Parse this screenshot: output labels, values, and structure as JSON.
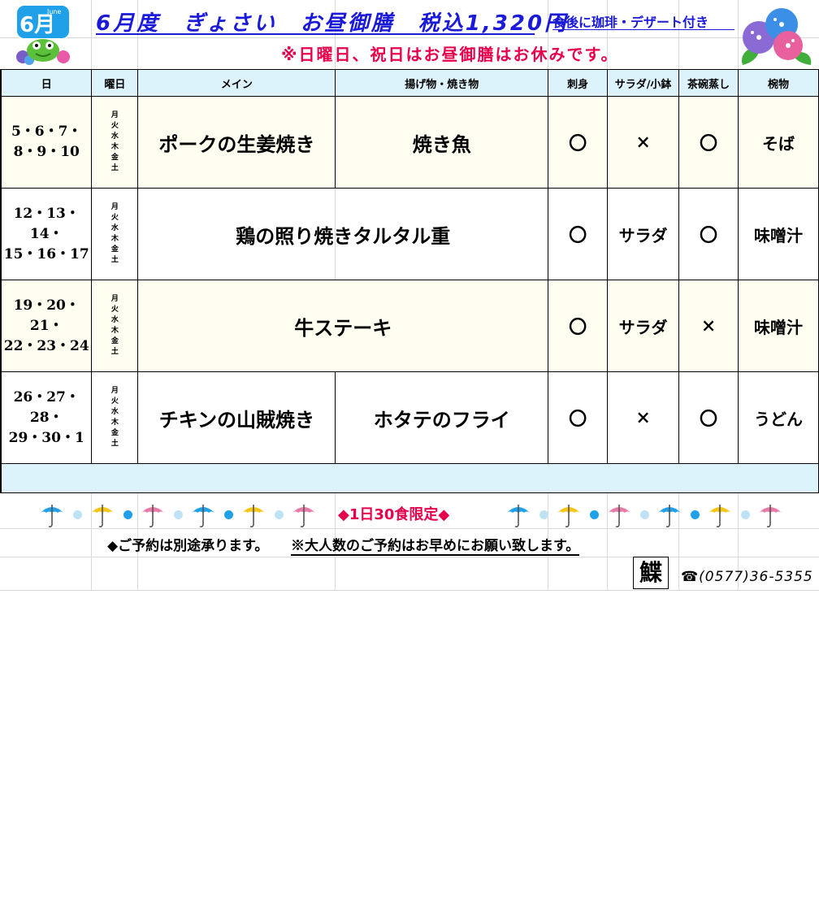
{
  "header": {
    "month_badge_number": "6月",
    "month_badge_en": "June",
    "title": "6月度　ぎょさい　お昼御膳　税込1,320円",
    "subtitle": "食後に珈琲・デザート付き",
    "notice": "※日曜日、祝日はお昼御膳はお休みです。"
  },
  "table": {
    "headers": [
      "日",
      "曜日",
      "メイン",
      "揚げ物・焼き物",
      "刺身",
      "サラダ/小鉢",
      "茶碗蒸し",
      "椀物"
    ],
    "rows": [
      {
        "date_line1": "5・6・7・",
        "date_line2": "8・9・10",
        "weekdays": [
          "月",
          "火",
          "水",
          "木",
          "金",
          "土"
        ],
        "main": "ポークの生姜焼き",
        "fried": "焼き魚",
        "sashimi": "〇",
        "salad": "×",
        "chawanmushi": "〇",
        "soup": "そば"
      },
      {
        "date_line1": "12・13・14・",
        "date_line2": "15・16・17",
        "weekdays": [
          "月",
          "火",
          "水",
          "木",
          "金",
          "土"
        ],
        "main": "鶏の照り焼きタルタル重",
        "sashimi": "〇",
        "salad": "サラダ",
        "chawanmushi": "〇",
        "soup": "味噌汁"
      },
      {
        "date_line1": "19・20・21・",
        "date_line2": "22・23・24",
        "weekdays": [
          "月",
          "火",
          "水",
          "木",
          "金",
          "土"
        ],
        "main": "牛ステーキ",
        "sashimi": "〇",
        "salad": "サラダ",
        "chawanmushi": "×",
        "soup": "味噌汁"
      },
      {
        "date_line1": "26・27・28・",
        "date_line2": "29・30・1",
        "weekdays": [
          "月",
          "火",
          "水",
          "木",
          "金",
          "土"
        ],
        "main": "チキンの山賊焼き",
        "fried": "ホタテのフライ",
        "sashimi": "〇",
        "salad": "×",
        "chawanmushi": "〇",
        "soup": "うどん"
      }
    ]
  },
  "footer": {
    "limit": "◆1日30食限定◆",
    "reserve_main": "◆ご予約は別途承ります。",
    "reserve_note": "※大人数のご予約はお早めにお願い致します。",
    "logo_char": "鰈",
    "phone": "☎(0577)36-5355"
  },
  "colors": {
    "title_blue": "#1a1ad8",
    "notice_red": "#e6004c",
    "header_bg": "#ddf3fb",
    "highlight_row_bg": "#fffef0"
  },
  "icons": [
    "calendar-badge-icon",
    "hydrangea-icon",
    "umbrella-icon",
    "raindrop-icon",
    "restaurant-logo"
  ]
}
